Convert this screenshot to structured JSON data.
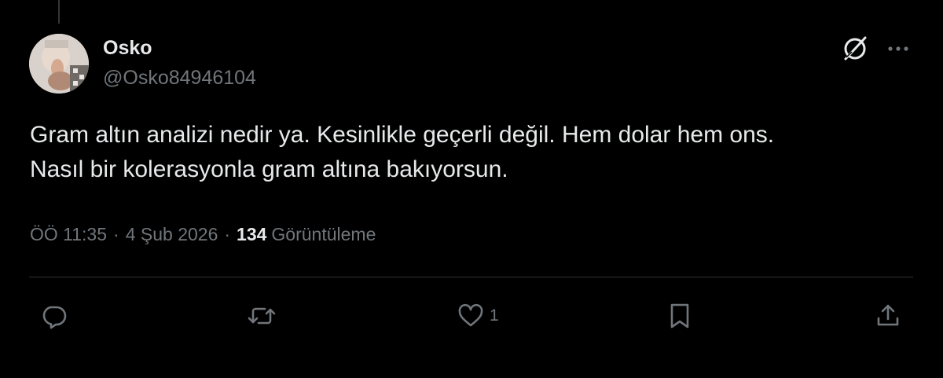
{
  "tweet": {
    "author": {
      "display_name": "Osko",
      "handle": "@Osko84946104"
    },
    "text": "Gram altın analizi nedir ya. Kesinlikle geçerli değil. Hem dolar hem ons.\nNasıl bir kolerasyonla gram altına bakıyorsun.",
    "time": "ÖÖ 11:35",
    "date": "4 Şub 2026",
    "separator": "·",
    "views_count": "134",
    "views_label": "Görüntüleme"
  },
  "actions": {
    "reply_icon": "reply-icon",
    "repost_icon": "repost-icon",
    "like_icon": "heart-icon",
    "like_count": "1",
    "bookmark_icon": "bookmark-icon",
    "share_icon": "share-icon"
  },
  "header_icons": {
    "grok": "grok-icon",
    "more": "more-options-icon"
  },
  "colors": {
    "background": "#000000",
    "primary_text": "#e7e9ea",
    "secondary_text": "#71767b",
    "divider": "#2f3336"
  }
}
